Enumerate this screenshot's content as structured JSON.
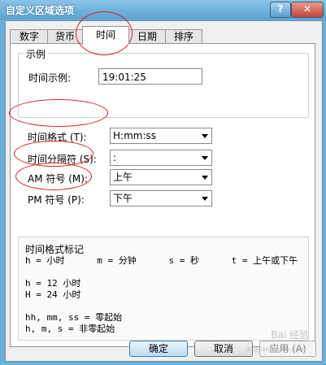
{
  "window": {
    "title": "自定义区域选项",
    "help_glyph": "?",
    "close_glyph": "✕"
  },
  "tabs": [
    {
      "label": "数字",
      "active": false
    },
    {
      "label": "货币",
      "active": false
    },
    {
      "label": "时间",
      "active": true
    },
    {
      "label": "日期",
      "active": false
    },
    {
      "label": "排序",
      "active": false
    }
  ],
  "sample": {
    "group_title": "示例",
    "label": "时间示例:",
    "value": "19:01:25"
  },
  "settings": [
    {
      "label": "时间格式 (T):",
      "value": "H:mm:ss"
    },
    {
      "label": "时间分隔符 (S):",
      "value": ":"
    },
    {
      "label": "AM 符号 (M):",
      "value": "上午"
    },
    {
      "label": "PM 符号 (P):",
      "value": "下午"
    }
  ],
  "notes": {
    "heading": "时间格式标记",
    "lines": [
      "h = 小时      m = 分钟      s = 秒      t = 上午或下午",
      "",
      "h = 12 小时",
      "H = 24 小时",
      "",
      "hh, mm, ss = 零起始",
      "h, m, s = 非零起始"
    ]
  },
  "buttons": {
    "ok": "确定",
    "cancel": "取消",
    "apply": "应用 (A)"
  },
  "watermark": {
    "text": "Bai 经验",
    "sub": "jingyan.baidu.com"
  }
}
